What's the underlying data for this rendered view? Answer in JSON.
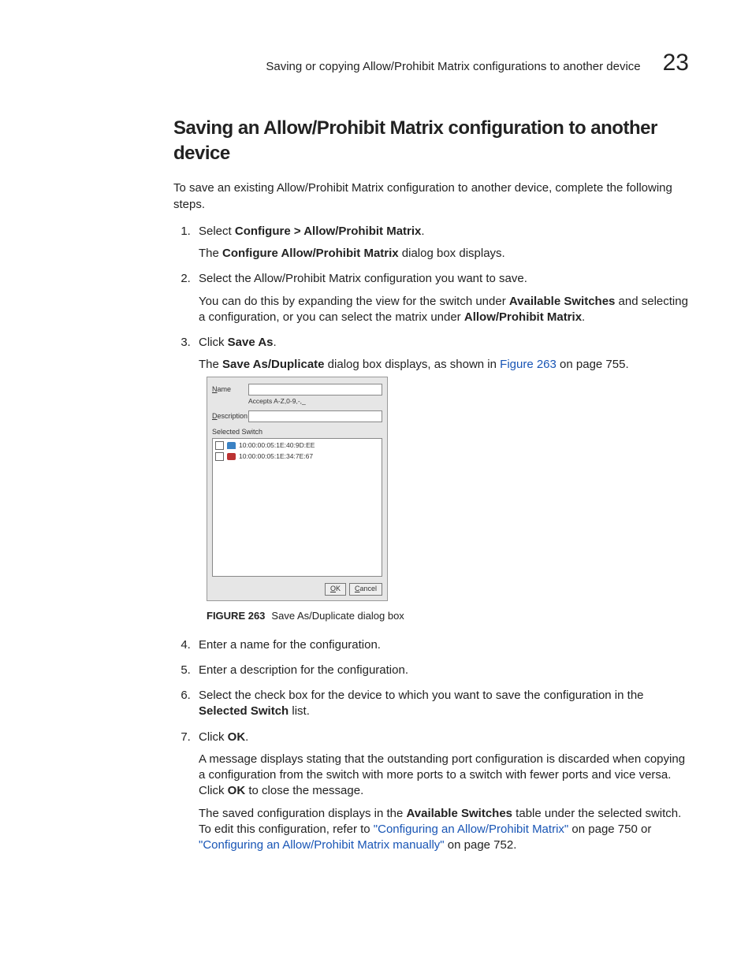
{
  "header": {
    "running_title": "Saving or copying Allow/Prohibit Matrix configurations to another device",
    "chapter_number": "23"
  },
  "section_title": "Saving an Allow/Prohibit Matrix configuration to another device",
  "intro": "To save an existing Allow/Prohibit Matrix configuration to another device, complete the following steps.",
  "steps": {
    "s1": {
      "pre": "Select ",
      "bold": "Configure > Allow/Prohibit Matrix",
      "post": ".",
      "body_pre": "The ",
      "body_bold": "Configure Allow/Prohibit Matrix",
      "body_post": " dialog box displays."
    },
    "s2": {
      "text": "Select the Allow/Prohibit Matrix configuration you want to save.",
      "body1_pre": "You can do this by expanding the view for the switch under ",
      "body1_bold": "Available Switches",
      "body1_mid": " and selecting a configuration, or you can select the matrix under ",
      "body1_bold2": "Allow/Prohibit Matrix",
      "body1_post": "."
    },
    "s3": {
      "pre": "Click ",
      "bold": "Save As",
      "post": ".",
      "body_pre": "The ",
      "body_bold": "Save As/Duplicate",
      "body_mid": " dialog box displays, as shown in ",
      "body_link": "Figure 263",
      "body_post": " on page 755."
    },
    "s4": "Enter a name for the configuration.",
    "s5": "Enter a description for the configuration.",
    "s6": {
      "pre": "Select the check box for the device to which you want to save the configuration in the ",
      "bold": "Selected Switch",
      "post": " list."
    },
    "s7": {
      "pre": "Click ",
      "bold": "OK",
      "post": ".",
      "body1_pre": "A message displays stating that the outstanding port configuration is discarded when copying a configuration from the switch with more ports to a switch with fewer ports and vice versa. Click ",
      "body1_bold": "OK",
      "body1_post": " to close the message.",
      "body2_pre": "The saved configuration displays in the ",
      "body2_bold": "Available Switches",
      "body2_mid": " table under the selected switch. To edit this configuration, refer to ",
      "body2_link1": "\"Configuring an Allow/Prohibit Matrix\"",
      "body2_mid2": " on page 750 or ",
      "body2_link2": "\"Configuring an Allow/Prohibit Matrix manually\"",
      "body2_post": " on page 752."
    }
  },
  "dialog": {
    "name_label": "Name",
    "name_hint": "Accepts A-Z,0-9,-,_",
    "desc_label": "Description",
    "list_header": "Selected Switch",
    "items": [
      "10:00:00:05:1E:40:9D:EE",
      "10:00:00:05:1E:34:7E:67"
    ],
    "ok": "OK",
    "cancel": "Cancel"
  },
  "figure": {
    "label": "FIGURE 263",
    "caption": "Save As/Duplicate dialog box"
  }
}
